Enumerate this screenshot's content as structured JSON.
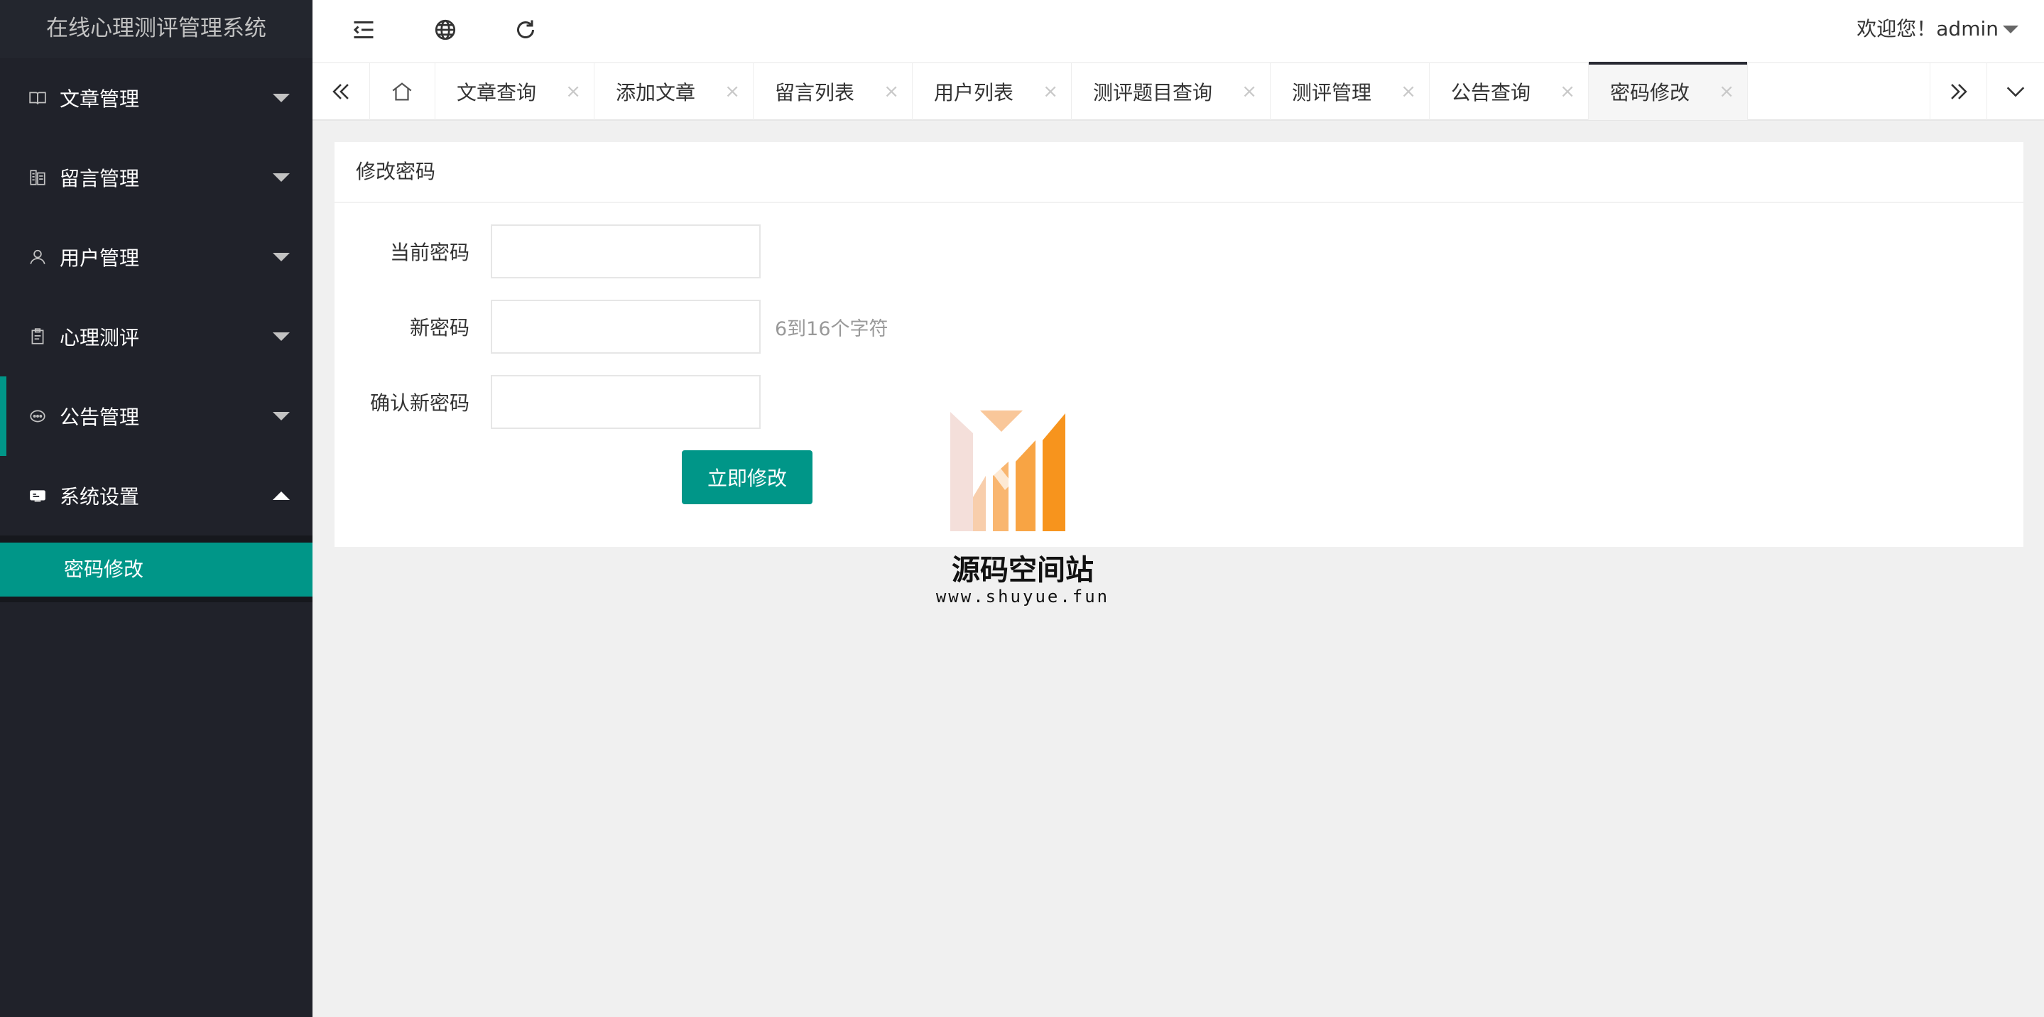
{
  "app": {
    "title": "在线心理测评管理系统"
  },
  "sidebar": {
    "items": [
      {
        "label": "文章管理",
        "icon": "book-icon",
        "expanded": false
      },
      {
        "label": "留言管理",
        "icon": "message-icon",
        "expanded": false
      },
      {
        "label": "用户管理",
        "icon": "user-icon",
        "expanded": false
      },
      {
        "label": "心理测评",
        "icon": "clipboard-icon",
        "expanded": false
      },
      {
        "label": "公告管理",
        "icon": "announcement-icon",
        "expanded": false
      },
      {
        "label": "系统设置",
        "icon": "settings-icon",
        "expanded": true
      }
    ],
    "sub_items": [
      {
        "label": "密码修改",
        "active": true
      }
    ]
  },
  "header": {
    "welcome": "欢迎您！admin",
    "icons": [
      "menu-fold-icon",
      "globe-icon",
      "refresh-icon"
    ]
  },
  "tabs": [
    {
      "label": "文章查询",
      "active": false
    },
    {
      "label": "添加文章",
      "active": false
    },
    {
      "label": "留言列表",
      "active": false
    },
    {
      "label": "用户列表",
      "active": false
    },
    {
      "label": "测评题目查询",
      "active": false
    },
    {
      "label": "测评管理",
      "active": false
    },
    {
      "label": "公告查询",
      "active": false
    },
    {
      "label": "密码修改",
      "active": true
    }
  ],
  "tab_close_glyph": "×",
  "form": {
    "title": "修改密码",
    "fields": [
      {
        "label": "当前密码",
        "value": "",
        "placeholder": "",
        "hint": ""
      },
      {
        "label": "新密码",
        "value": "",
        "placeholder": "",
        "hint": "6到16个字符"
      },
      {
        "label": "确认新密码",
        "value": "",
        "placeholder": "",
        "hint": ""
      }
    ],
    "submit_label": "立即修改"
  },
  "watermark": {
    "title": "源码空间站",
    "url": "www.shuyue.fun"
  },
  "colors": {
    "sidebar_bg": "#20222a",
    "accent": "#009688",
    "page_bg": "#f0f0f0",
    "watermark_orange": "#f7941d"
  }
}
